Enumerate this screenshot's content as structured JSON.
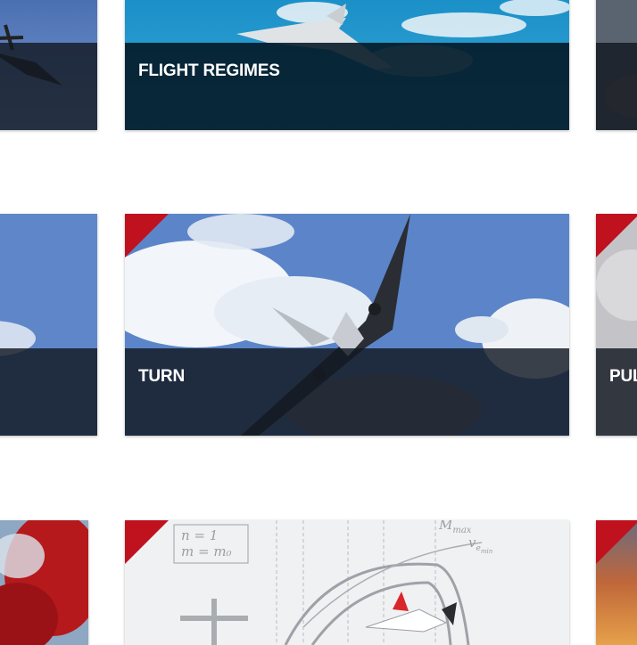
{
  "accent_color": "#c0111f",
  "cards": [
    {
      "title": "",
      "image": "propeller-aircraft-photo"
    },
    {
      "title": "FLIGHT REGIMES",
      "image": "fighter-jet-photo"
    },
    {
      "title": "",
      "image": "sky-photo"
    },
    {
      "title": "",
      "image": "sky-photo"
    },
    {
      "title": "TURN",
      "image": "airliner-banking-photo"
    },
    {
      "title": "PUL",
      "image": "sky-photo"
    },
    {
      "title": "",
      "image": "red-smoke-photo"
    },
    {
      "title": "",
      "image": "flight-envelope-diagram"
    },
    {
      "title": "",
      "image": "sunset-photo"
    }
  ],
  "diagram": {
    "n_label": "n = 1",
    "m_label": "m = m₀",
    "mmax_label": "M",
    "mmax_sub": "max",
    "ve_label": "v",
    "ve_sub": "e",
    "ve_subsub": "min"
  }
}
